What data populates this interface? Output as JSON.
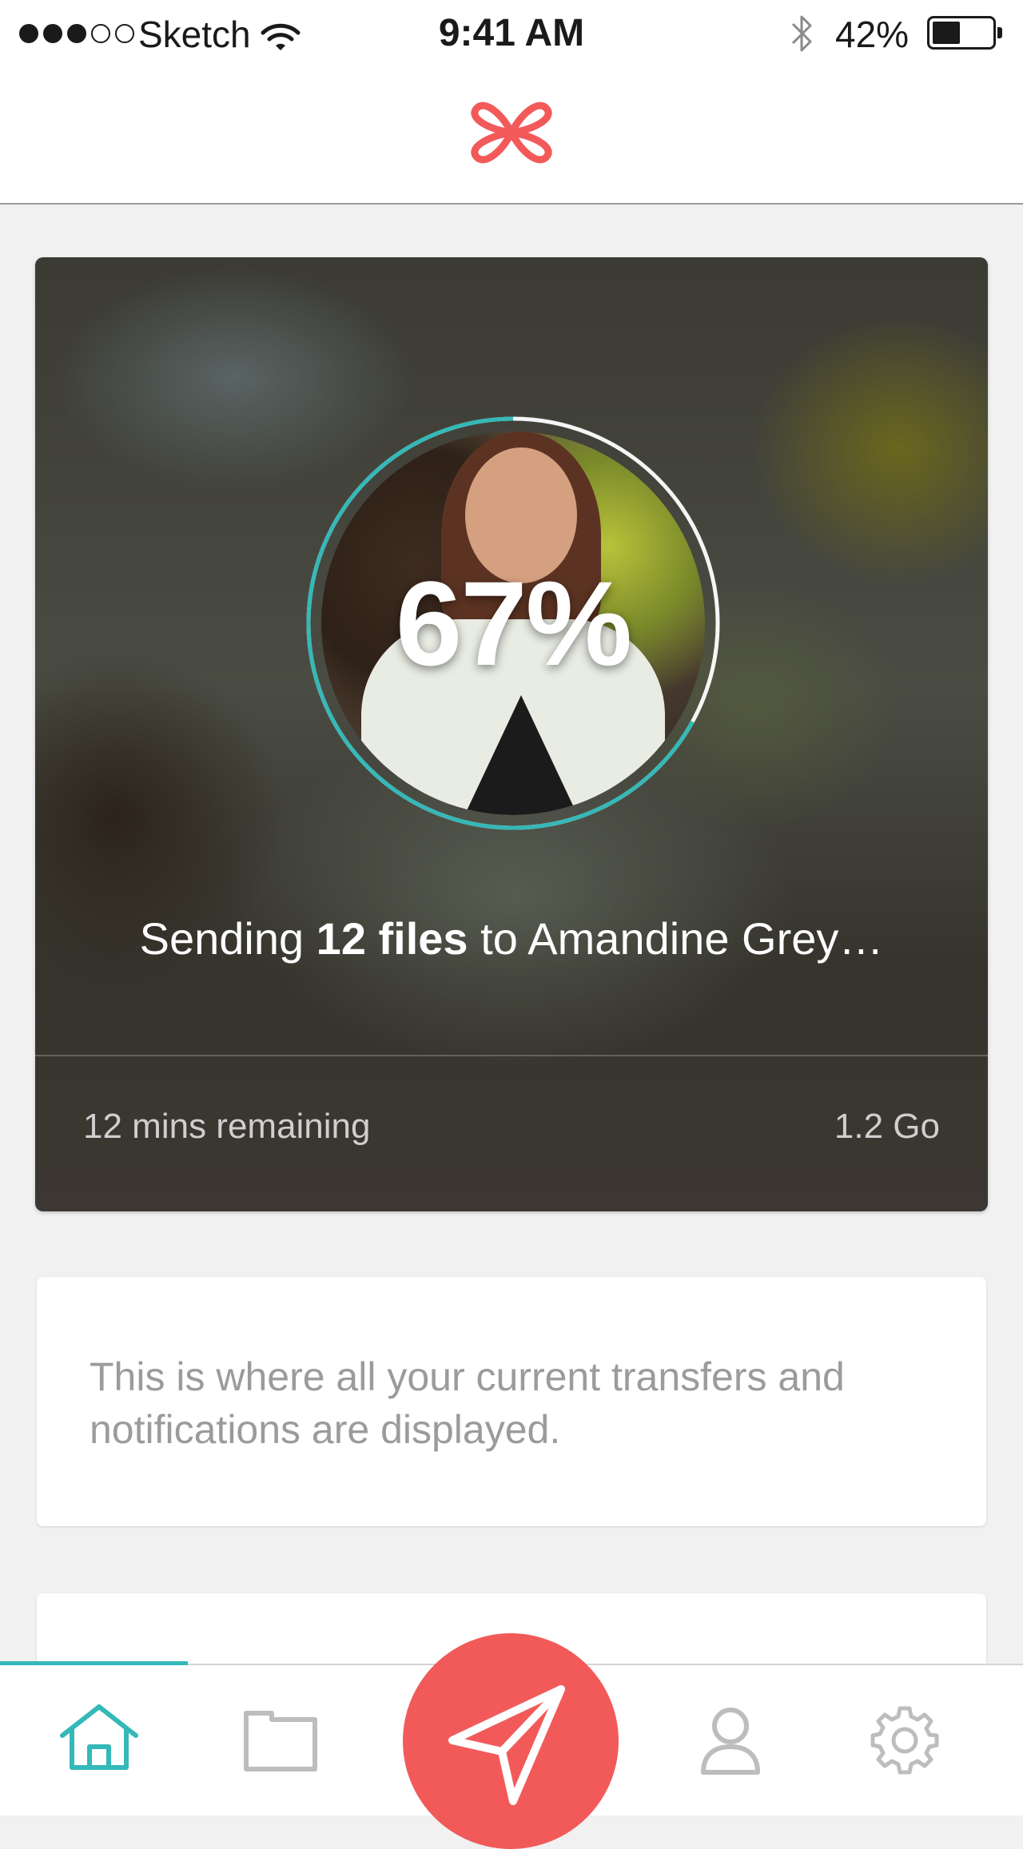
{
  "status_bar": {
    "carrier": "Sketch",
    "time": "9:41 AM",
    "battery_percent": "42%",
    "battery_level": 0.42,
    "signal_bars_filled": 3,
    "signal_bars_total": 5
  },
  "header": {
    "logo_icon": "quatrefoil-logo",
    "brand_color": "#f25a5a"
  },
  "transfer": {
    "progress_label": "67%",
    "progress_value": 0.67,
    "status_prefix": "Sending ",
    "file_count": "12 files",
    "status_suffix": " to Amandine Grey…",
    "time_remaining": "12 mins remaining",
    "total_size": "1.2 Go",
    "accent_color": "#35b8b8"
  },
  "info_card": {
    "message": "This is where all your current transfers and notifications are displayed."
  },
  "tab_bar": {
    "items": [
      {
        "name": "home",
        "icon": "home-icon",
        "active": true
      },
      {
        "name": "files",
        "icon": "folder-icon",
        "active": false
      },
      {
        "name": "send",
        "icon": "send-icon",
        "active": false
      },
      {
        "name": "profile",
        "icon": "user-icon",
        "active": false
      },
      {
        "name": "settings",
        "icon": "gear-icon",
        "active": false
      }
    ],
    "active_color": "#35b8b8",
    "inactive_color": "#bdbdbd"
  }
}
